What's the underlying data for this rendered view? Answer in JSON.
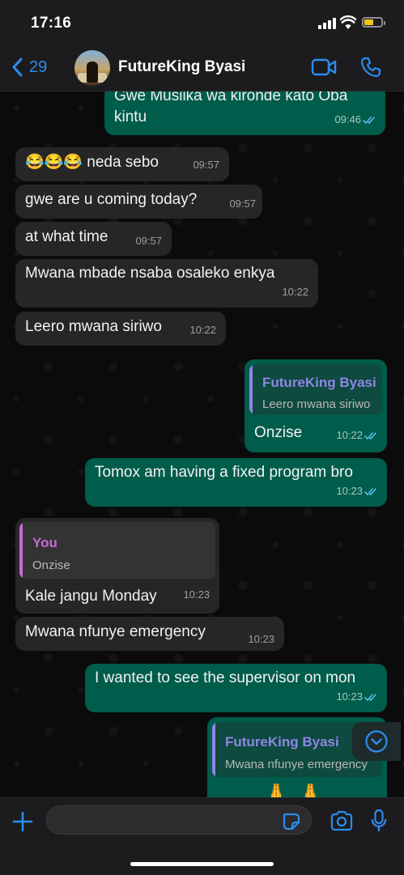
{
  "status_bar": {
    "time": "17:16"
  },
  "header": {
    "back_count": "29",
    "contact_name": "FutureKing Byasi"
  },
  "messages": [
    {
      "dir": "out",
      "text": "Gwe Musiika wa kironde kato Oba kintu",
      "time": "09:46"
    },
    {
      "dir": "in",
      "text": "😂😂😂 neda sebo",
      "time": "09:57"
    },
    {
      "dir": "in",
      "text": "gwe are u coming today?",
      "time": "09:57"
    },
    {
      "dir": "in",
      "text": "at what time",
      "time": "09:57"
    },
    {
      "dir": "in",
      "text": "Mwana mbade nsaba osaleko enkya",
      "time": "10:22"
    },
    {
      "dir": "in",
      "text": "Leero mwana siriwo",
      "time": "10:22"
    },
    {
      "dir": "out",
      "quote_name": "FutureKing Byasi",
      "quote_text": "Leero mwana siriwo",
      "text": "Onzise",
      "time": "10:22"
    },
    {
      "dir": "out",
      "text": "Tomox am having a fixed program bro",
      "time": "10:23"
    },
    {
      "dir": "in",
      "quote_name": "You",
      "quote_text": "Onzise",
      "text": "Kale jangu Monday",
      "time": "10:23"
    },
    {
      "dir": "in",
      "text": "Mwana nfunye emergency",
      "time": "10:23"
    },
    {
      "dir": "out",
      "text": "I wanted to see the supervisor on mon",
      "time": "10:23"
    },
    {
      "dir": "out",
      "quote_name": "FutureKing Byasi",
      "quote_text": "Mwana nfunye emergency",
      "text": "🙏🙏",
      "time": ""
    }
  ],
  "input": {
    "value": "",
    "placeholder": ""
  },
  "colors": {
    "accent": "#2d8cf0",
    "outgoing_bubble": "#005c4b",
    "incoming_bubble": "#262626",
    "quote_you": "#c56bd6",
    "quote_contact": "#8e86e6",
    "read_ticks": "#53bdeb"
  },
  "icons": [
    "chevron-left-icon",
    "video-call-icon",
    "phone-icon",
    "scroll-down-icon",
    "plus-icon",
    "sticker-icon",
    "camera-icon",
    "microphone-icon"
  ]
}
